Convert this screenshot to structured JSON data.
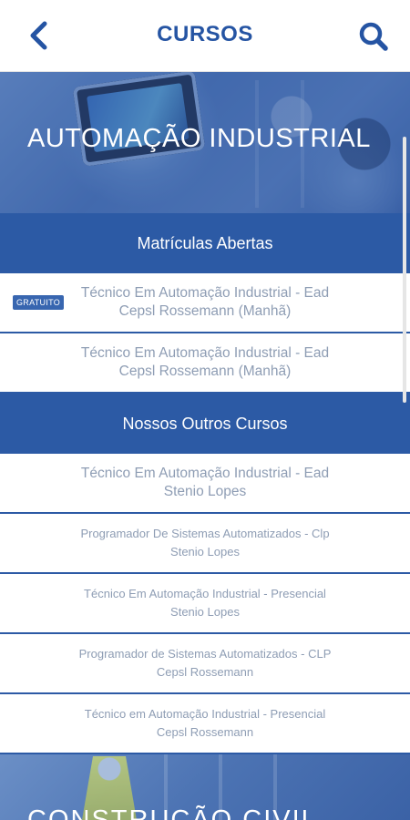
{
  "header": {
    "title": "CURSOS",
    "back_icon": "chevron-left-icon",
    "search_icon": "search-icon"
  },
  "categories": [
    {
      "title": "AUTOMAÇÃO INDUSTRIAL"
    },
    {
      "title": "CONSTRUÇÃO CIVIL"
    }
  ],
  "sections": {
    "open": "Matrículas Abertas",
    "others": "Nossos Outros Cursos"
  },
  "open_courses": [
    {
      "badge": "GRATUITO",
      "line1": "Técnico Em Automação Industrial - Ead",
      "line2": "Cepsl Rossemann (Manhã)"
    },
    {
      "line1": "Técnico Em Automação Industrial - Ead",
      "line2": "Cepsl Rossemann (Manhã)"
    }
  ],
  "other_courses": [
    {
      "line1": "Técnico Em Automação Industrial - Ead",
      "line2": "Stenio Lopes"
    },
    {
      "line1": "Programador De Sistemas Automatizados - Clp",
      "line2": "Stenio Lopes"
    },
    {
      "line1": "Técnico Em Automação Industrial - Presencial",
      "line2": "Stenio Lopes"
    },
    {
      "line1": "Programador de Sistemas Automatizados - CLP",
      "line2": "Cepsl Rossemann"
    },
    {
      "line1": "Técnico em Automação Industrial - Presencial",
      "line2": "Cepsl Rossemann"
    }
  ],
  "colors": {
    "primary": "#2c5aa5",
    "header_text": "#2554a3",
    "item_text": "#8e9db4"
  }
}
